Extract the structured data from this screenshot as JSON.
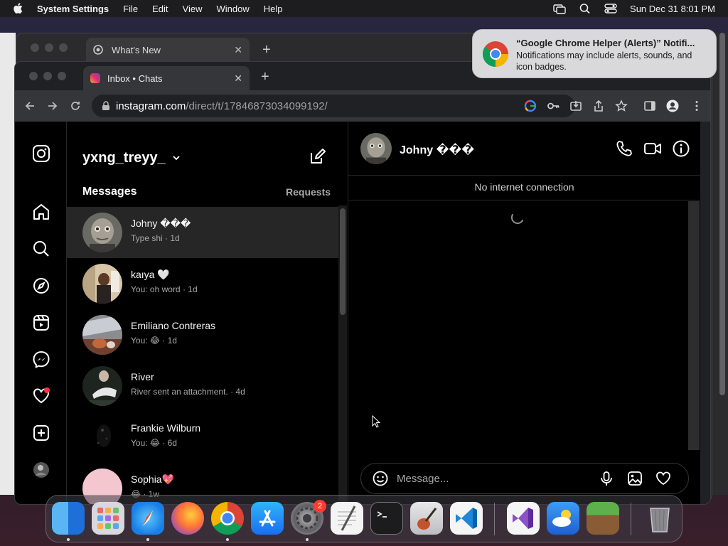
{
  "menubar": {
    "app": "System Settings",
    "items": [
      "File",
      "Edit",
      "View",
      "Window",
      "Help"
    ],
    "clock": "Sun Dec 31  8:01 PM"
  },
  "back_window": {
    "tab_title": "What's New"
  },
  "browser": {
    "tab_title": "Inbox • Chats",
    "url_host": "instagram.com",
    "url_path": "/direct/t/17846873034099192/"
  },
  "sidebar": {
    "username": "yxng_treyy_",
    "messages_label": "Messages",
    "requests_label": "Requests"
  },
  "conversations": [
    {
      "name": "Johny ���",
      "preview": "Type shi · 1d",
      "selected": true
    },
    {
      "name": "kaıya 🤍",
      "preview": "You: oh word · 1d",
      "selected": false
    },
    {
      "name": "Emiliano Contreras",
      "preview": "You: 😂 · 1d",
      "selected": false
    },
    {
      "name": "River",
      "preview": "River sent an attachment. · 4d",
      "selected": false
    },
    {
      "name": "Frankie Wilburn",
      "preview": "You: 😂 · 6d",
      "selected": false
    },
    {
      "name": "Sophia💖",
      "preview": "😂 · 1w",
      "selected": false
    }
  ],
  "chat": {
    "contact_name": "Johny ���",
    "status_banner": "No internet connection",
    "input_placeholder": "Message..."
  },
  "notification": {
    "title": "“Google Chrome Helper (Alerts)” Notifi...",
    "body": "Notifications may include alerts, sounds, and icon badges."
  },
  "dock": {
    "system_settings_badge": "2"
  },
  "colors": {
    "ig_background": "#000000",
    "ig_selected_row": "#262626",
    "notification_dot": "#ff3040",
    "chrome_toolbar": "#35363a"
  }
}
